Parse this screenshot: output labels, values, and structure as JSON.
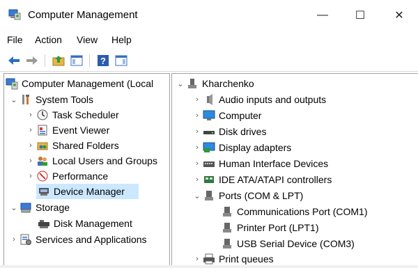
{
  "window": {
    "title": "Computer Management",
    "controls": {
      "minimize": "—",
      "maximize": "☐",
      "close": "✕"
    }
  },
  "menu": {
    "items": [
      "File",
      "Action",
      "View",
      "Help"
    ]
  },
  "left_tree": [
    {
      "label": "Computer Management (Local",
      "icon": "computer-management-icon"
    },
    {
      "label": "System Tools",
      "icon": "tools-icon"
    },
    {
      "label": "Task Scheduler",
      "icon": "clock-icon"
    },
    {
      "label": "Event Viewer",
      "icon": "event-viewer-icon"
    },
    {
      "label": "Shared Folders",
      "icon": "shared-folder-icon"
    },
    {
      "label": "Local Users and Groups",
      "icon": "users-icon"
    },
    {
      "label": "Performance",
      "icon": "performance-icon"
    },
    {
      "label": "Device Manager",
      "icon": "device-manager-icon",
      "selected": true
    },
    {
      "label": "Storage",
      "icon": "storage-icon"
    },
    {
      "label": "Disk Management",
      "icon": "disk-management-icon"
    },
    {
      "label": "Services and Applications",
      "icon": "services-icon"
    }
  ],
  "right_tree": [
    {
      "label": "Kharchenko",
      "icon": "computer-node-icon"
    },
    {
      "label": "Audio inputs and outputs",
      "icon": "speaker-icon"
    },
    {
      "label": "Computer",
      "icon": "monitor-icon"
    },
    {
      "label": "Disk drives",
      "icon": "disk-drive-icon"
    },
    {
      "label": "Display adapters",
      "icon": "display-adapter-icon"
    },
    {
      "label": "Human Interface Devices",
      "icon": "hid-icon"
    },
    {
      "label": "IDE ATA/ATAPI controllers",
      "icon": "ide-controller-icon"
    },
    {
      "label": "Ports (COM & LPT)",
      "icon": "port-icon"
    },
    {
      "label": "Communications Port (COM1)",
      "icon": "port-icon"
    },
    {
      "label": "Printer Port (LPT1)",
      "icon": "port-icon"
    },
    {
      "label": "USB Serial Device (COM3)",
      "icon": "port-icon"
    },
    {
      "label": "Print queues",
      "icon": "printer-icon"
    }
  ]
}
